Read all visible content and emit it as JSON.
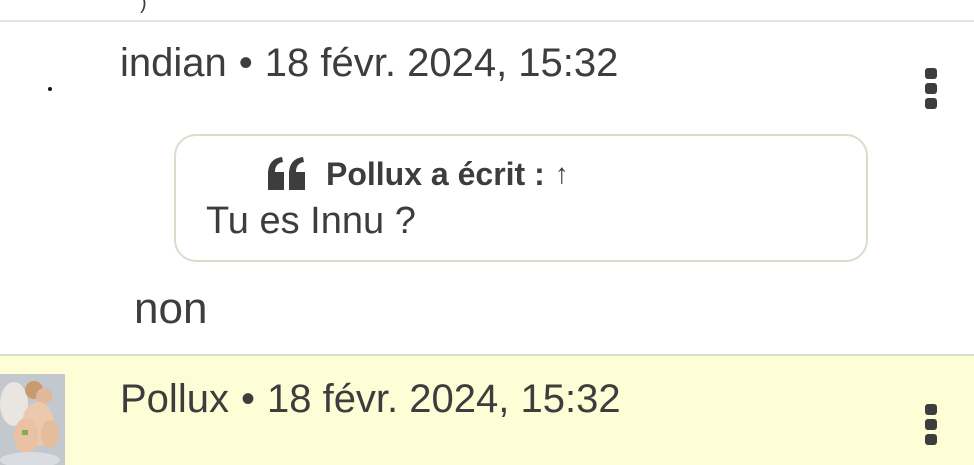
{
  "posts": [
    {
      "author": "indian",
      "separator": "•",
      "timestamp": "18 févr. 2024, 15:32",
      "quote": {
        "header": "Pollux a écrit :",
        "link_arrow": "↑",
        "text": "Tu es Innu ?"
      },
      "body": "non"
    },
    {
      "author": "Pollux",
      "separator": "•",
      "timestamp": "18 févr. 2024, 15:32"
    }
  ],
  "icons": {
    "quote": "quote-icon",
    "menu": "more-vertical-icon"
  },
  "colors": {
    "text": "#3d3d3d",
    "highlight_row": "#fdfdd6",
    "quote_border": "#dcdccd",
    "divider": "#e2e2e2"
  }
}
